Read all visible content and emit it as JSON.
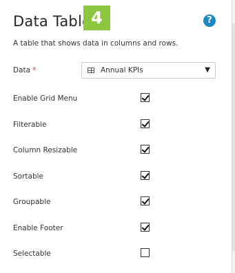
{
  "header": {
    "title": "Data Table",
    "step": "4",
    "help_icon": "question-circle-icon",
    "help_glyph": "?"
  },
  "subtitle": "A table that shows data in columns and rows.",
  "data_field": {
    "label": "Data",
    "required_mark": "*",
    "value": "Annual KPIs",
    "icon": "table-icon",
    "chevron": "▼"
  },
  "options": [
    {
      "label": "Enable Grid Menu",
      "checked": true
    },
    {
      "label": "Filterable",
      "checked": true
    },
    {
      "label": "Column Resizable",
      "checked": true
    },
    {
      "label": "Sortable",
      "checked": true
    },
    {
      "label": "Groupable",
      "checked": true
    },
    {
      "label": "Enable Footer",
      "checked": true
    },
    {
      "label": "Selectable",
      "checked": false
    }
  ],
  "colors": {
    "step_badge": "#8dc63f",
    "help_icon": "#1e88c7",
    "required": "#d9362b"
  }
}
